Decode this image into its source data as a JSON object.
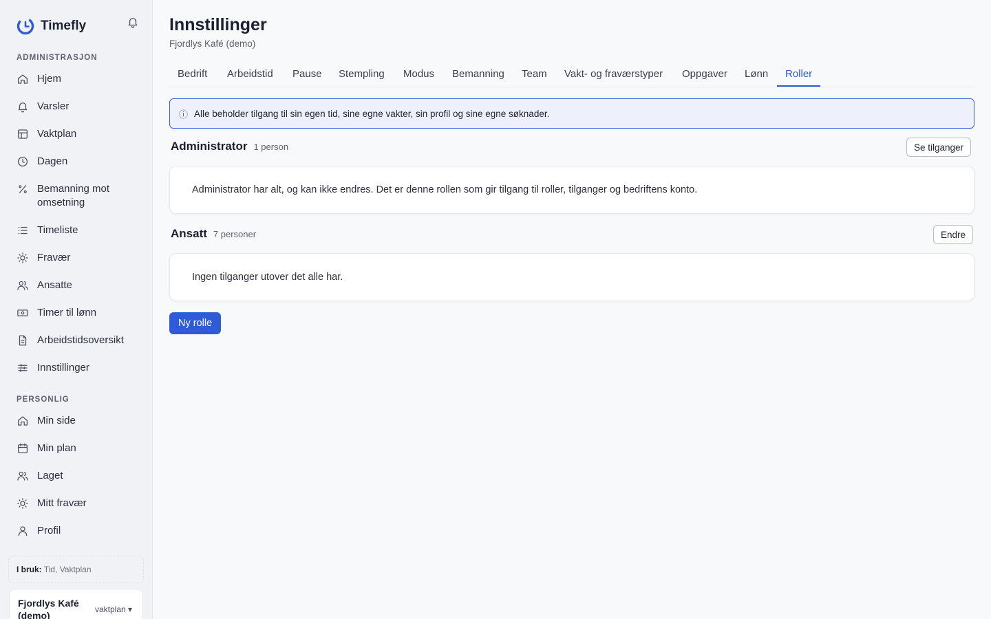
{
  "app": {
    "name": "Timefly",
    "accent": "#2f5bd8"
  },
  "sidebar": {
    "admin_label": "ADMINISTRASJON",
    "admin_items": [
      {
        "label": "Hjem",
        "icon": "home-icon"
      },
      {
        "label": "Varsler",
        "icon": "bell-icon"
      },
      {
        "label": "Vaktplan",
        "icon": "table-icon"
      },
      {
        "label": "Dagen",
        "icon": "clock-icon"
      },
      {
        "label": "Bemanning mot omsetning",
        "icon": "percent-icon"
      },
      {
        "label": "Timeliste",
        "icon": "list-icon"
      },
      {
        "label": "Fravær",
        "icon": "sun-icon"
      },
      {
        "label": "Ansatte",
        "icon": "users-icon"
      },
      {
        "label": "Timer til lønn",
        "icon": "banknote-icon"
      },
      {
        "label": "Arbeidstidsoversikt",
        "icon": "document-icon"
      },
      {
        "label": "Innstillinger",
        "icon": "sliders-icon"
      }
    ],
    "personal_label": "PERSONLIG",
    "personal_items": [
      {
        "label": "Min side",
        "icon": "home-icon"
      },
      {
        "label": "Min plan",
        "icon": "calendar-icon"
      },
      {
        "label": "Laget",
        "icon": "users-icon"
      },
      {
        "label": "Mitt fravær",
        "icon": "sun-icon"
      },
      {
        "label": "Profil",
        "icon": "user-icon"
      }
    ],
    "in_use_label": "I bruk:",
    "in_use_value": "Tid, Vaktplan",
    "company_name": "Fjordlys Kafé (demo)",
    "company_plan": "vaktplan ▾"
  },
  "page": {
    "title": "Innstillinger",
    "subtitle": "Fjordlys Kafé (demo)"
  },
  "tabs": [
    "Bedrift",
    "Arbeidstid",
    "Pause",
    "Stempling",
    "Modus",
    "Bemanning",
    "Team",
    "Vakt- og fraværstyper",
    "Oppgaver",
    "Lønn",
    "Roller"
  ],
  "active_tab": "Roller",
  "info_text": "Alle beholder tilgang til sin egen tid, sine egne vakter, sin profil og sine egne søknader.",
  "roles": [
    {
      "name": "Administrator",
      "count": "1 person",
      "button": "Se tilganger",
      "description": "Administrator har alt, og kan ikke endres. Det er denne rollen som gir tilgang til roller, tilganger og bedriftens konto."
    },
    {
      "name": "Ansatt",
      "count": "7 personer",
      "button": "Endre",
      "description": "Ingen tilganger utover det alle har."
    }
  ],
  "new_role_button": "Ny rolle"
}
